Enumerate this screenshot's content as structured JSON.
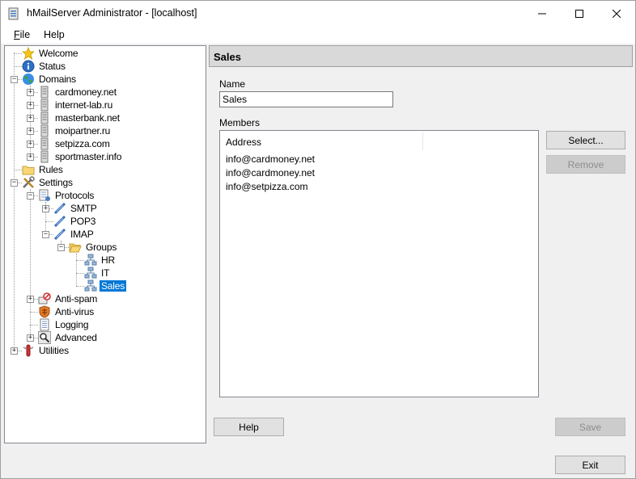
{
  "window": {
    "title": "hMailServer Administrator - [localhost]",
    "controls": {
      "minimize": "–",
      "maximize": "☐",
      "close": "✕"
    }
  },
  "menu": [
    {
      "label": "File",
      "mnemonic": "F",
      "rest": "ile"
    },
    {
      "label": "Help",
      "mnemonic": "",
      "rest": "Help"
    }
  ],
  "tree": {
    "welcome": "Welcome",
    "status": "Status",
    "domains": "Domains",
    "domain_items": [
      "cardmoney.net",
      "internet-lab.ru",
      "masterbank.net",
      "moipartner.ru",
      "setpizza.com",
      "sportmaster.info"
    ],
    "rules": "Rules",
    "settings": "Settings",
    "protocols": "Protocols",
    "smtp": "SMTP",
    "pop3": "POP3",
    "imap": "IMAP",
    "groups": "Groups",
    "group_items": [
      "HR",
      "IT",
      "Sales"
    ],
    "antispam": "Anti-spam",
    "antivirus": "Anti-virus",
    "logging": "Logging",
    "advanced": "Advanced",
    "utilities": "Utilities"
  },
  "header": {
    "title": "Sales"
  },
  "form": {
    "name_label": "Name",
    "name_value": "Sales",
    "members_label": "Members",
    "column_address": "Address",
    "members": [
      "info@cardmoney.net",
      "info@cardmoney.net",
      "info@setpizza.com"
    ]
  },
  "buttons": {
    "select": "Select...",
    "remove": "Remove",
    "help": "Help",
    "save": "Save",
    "exit": "Exit"
  }
}
